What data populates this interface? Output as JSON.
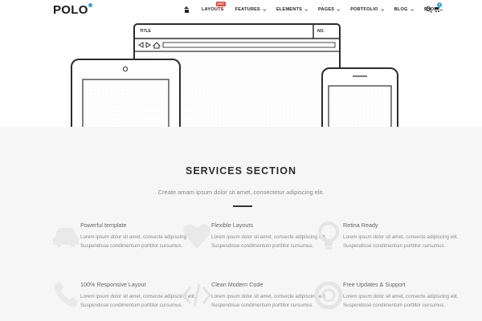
{
  "header": {
    "logo": "POLO",
    "brand_color": "#2aa8e0",
    "nav": [
      {
        "label": "LAYOUTS",
        "badge": "HOT"
      },
      {
        "label": "FEATURES"
      },
      {
        "label": "ELEMENTS"
      },
      {
        "label": "PAGES"
      },
      {
        "label": "PORTFOLIO"
      },
      {
        "label": "BLOG"
      },
      {
        "label": "SHOP"
      }
    ],
    "cart_count": "0"
  },
  "hero": {
    "wireframe_title": "TITLE",
    "wireframe_no": "NO."
  },
  "services": {
    "title": "SERVICES SECTION",
    "subtitle": "Create amam ipsum dolor sit amet, consectetur adipiscing elit.",
    "features": [
      {
        "icon": "car-icon",
        "title": "Powerful template",
        "text": "Lorem ipsum dolor sit amet, consecte adipiscing elit. Suspendisse condimentum porttitor cursumus."
      },
      {
        "icon": "heart-icon",
        "title": "Flexible Layouts",
        "text": "Lorem ipsum dolor sit amet, consecte adipiscing elit. Suspendisse condimentum porttitor cursumus."
      },
      {
        "icon": "lightbulb-icon",
        "title": "Retina Ready",
        "text": "Lorem ipsum dolor sit amet, consecte adipiscing elit. Suspendisse condimentum porttitor cursumus."
      },
      {
        "icon": "phone-icon",
        "title": "100% Responsive Layout",
        "text": "Lorem ipsum dolor sit amet, consecte adipiscing elit. Suspendisse condimentum porttitor cursumus."
      },
      {
        "icon": "code-icon",
        "title": "Clean Modern Code",
        "text": "Lorem ipsum dolor sit amet, consecte adipiscing elit. Suspendisse condimentum porttitor cursumus."
      },
      {
        "icon": "lifebuoy-icon",
        "title": "Free Updates & Support",
        "text": "Lorem ipsum dolor sit amet, consecte adipiscing elit. Suspendisse condimentum porttitor cursumus."
      }
    ]
  }
}
